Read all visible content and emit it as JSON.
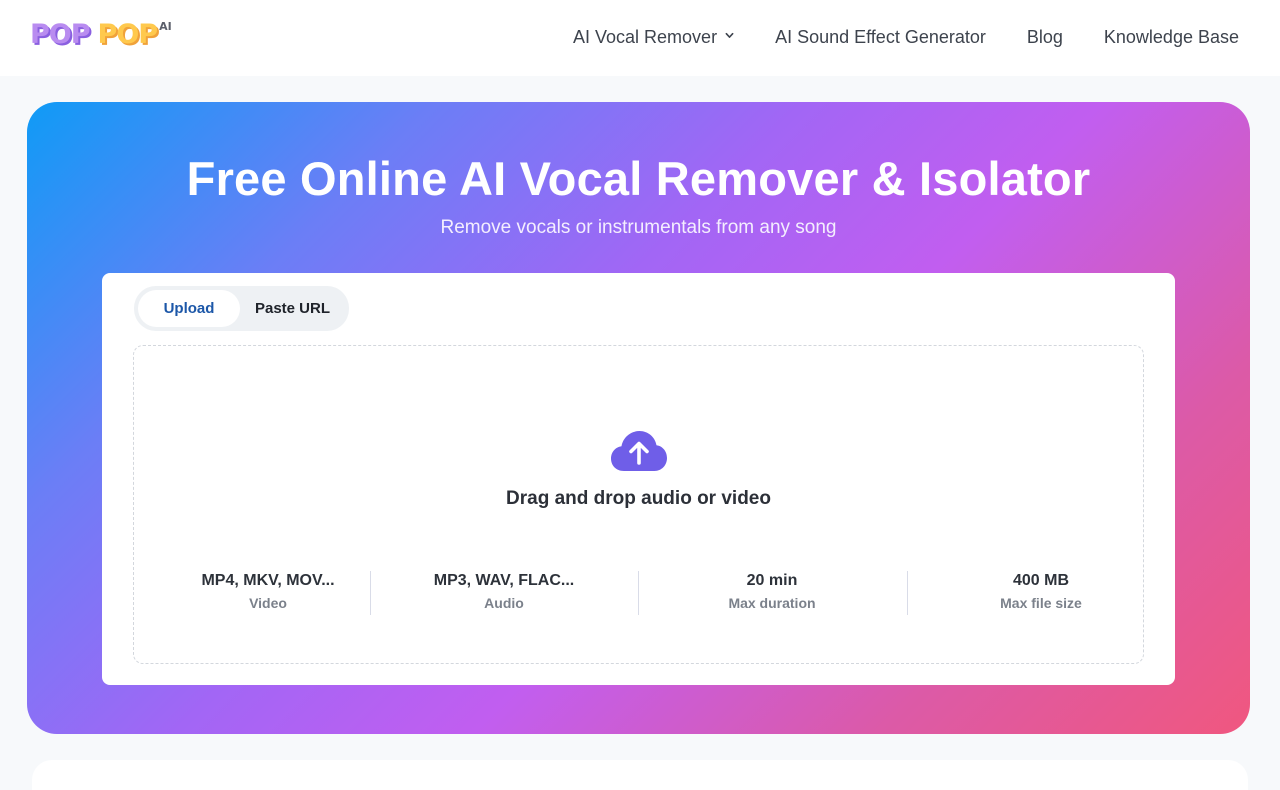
{
  "header": {
    "logo": {
      "word1": "POP",
      "word2": "POP",
      "suffix": "AI"
    },
    "nav": [
      {
        "label": "AI Vocal Remover",
        "has_dropdown": true
      },
      {
        "label": "AI Sound Effect Generator"
      },
      {
        "label": "Blog"
      },
      {
        "label": "Knowledge Base"
      }
    ]
  },
  "hero": {
    "title": "Free Online AI Vocal Remover & Isolator",
    "subtitle": "Remove vocals or instrumentals from any song",
    "gradient_colors": [
      "#0f9bf6",
      "#a266f5",
      "#c15ef0",
      "#f0577f"
    ]
  },
  "uploader": {
    "tabs": [
      {
        "label": "Upload",
        "active": true
      },
      {
        "label": "Paste URL",
        "active": false
      }
    ],
    "icon": "cloud-upload-icon",
    "icon_color": "#6f5ee8",
    "drop_label": "Drag and drop audio or video",
    "specs": [
      {
        "value": "MP4, MKV, MOV...",
        "label": "Video"
      },
      {
        "value": "MP3, WAV, FLAC...",
        "label": "Audio"
      },
      {
        "value": "20 min",
        "label": "Max duration"
      },
      {
        "value": "400 MB",
        "label": "Max file size"
      }
    ]
  }
}
